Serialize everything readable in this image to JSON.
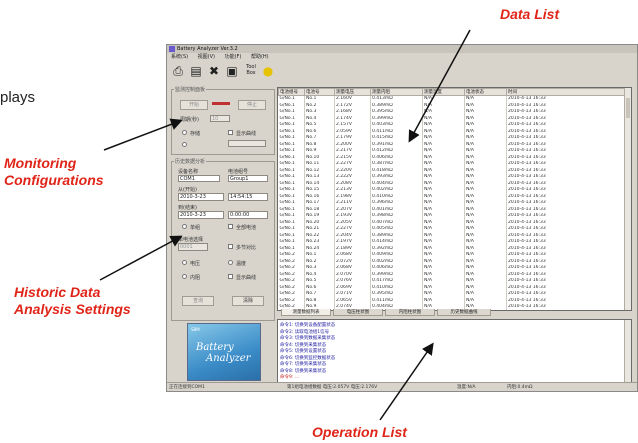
{
  "callouts": {
    "plays_fragment": "plays",
    "monitoring": [
      "Monitoring",
      "Configurations"
    ],
    "historic": [
      "Historic Data",
      "Analysis Settings"
    ],
    "data_list": "Data List",
    "operation_list": "Operation List"
  },
  "window": {
    "title": "Battery Analyzer Ver.3.2",
    "menu": [
      "系统(S)",
      "视图(V)",
      "功能(F)",
      "帮助(H)"
    ],
    "toolbar": {
      "icons": [
        "printer-icon",
        "page-icon",
        "tools-icon",
        "filter-icon",
        "tool-label-icon",
        "bulb-icon"
      ],
      "tool_label": "Tool Box"
    }
  },
  "monitor": {
    "title": "监测控制面板",
    "start": "开始",
    "stop": "停止",
    "period_label": "周期(秒)",
    "period_value": "10",
    "save_label": "存储",
    "display_label": "显示曲线"
  },
  "history": {
    "title": "历史数据分析",
    "device_label": "设备名称",
    "device_value": "COM1",
    "battery_label": "电池组号",
    "battery_value": "Group1",
    "from_label": "从(开始)",
    "from_date": "2010-3-23",
    "from_time": "14:54:15",
    "to_label": "到(结束)",
    "to_date": "2010-3-23",
    "to_time": "0:00:00",
    "opt_single": "单组",
    "opt_multi": "全部电池",
    "single_cell_label": "单电池选择",
    "single_cell_value": "0001",
    "compare_label": "多节对比",
    "voltage": "电压",
    "internal": "内阻",
    "temp": "温度",
    "curve": "显示曲线",
    "query": "查询",
    "clear": "清除"
  },
  "logo": {
    "line1": "Battery",
    "line2": "Analyzer",
    "small": "SBM"
  },
  "table": {
    "columns": [
      "电池组号",
      "电池号",
      "测量电压",
      "测量内阻",
      "测量温度",
      "电池状态",
      "时间"
    ],
    "rows": [
      [
        "G/No.1",
        "No.1",
        "2.160V",
        "0.413mΩ",
        "N/A",
        "N/A",
        "2010-4-13 16:33"
      ],
      [
        "G/No.1",
        "No.2",
        "2.172V",
        "0.389mΩ",
        "N/A",
        "N/A",
        "2010-4-13 16:33"
      ],
      [
        "G/No.1",
        "No.3",
        "2.168V",
        "0.395mΩ",
        "N/A",
        "N/A",
        "2010-4-13 16:33"
      ],
      [
        "G/No.1",
        "No.4",
        "2.174V",
        "0.399mΩ",
        "N/A",
        "N/A",
        "2010-4-13 16:33"
      ],
      [
        "G/No.1",
        "No.5",
        "2.157V",
        "0.403mΩ",
        "N/A",
        "N/A",
        "2010-4-13 16:33"
      ],
      [
        "G/No.1",
        "No.6",
        "2.059V",
        "0.411mΩ",
        "N/A",
        "N/A",
        "2010-4-13 16:33"
      ],
      [
        "G/No.1",
        "No.7",
        "2.179V",
        "0.415mΩ",
        "N/A",
        "N/A",
        "2010-4-13 16:33"
      ],
      [
        "G/No.1",
        "No.8",
        "2.200V",
        "0.391mΩ",
        "N/A",
        "N/A",
        "2010-4-13 16:33"
      ],
      [
        "G/No.1",
        "No.9",
        "2.217V",
        "0.412mΩ",
        "N/A",
        "N/A",
        "2010-4-13 16:33"
      ],
      [
        "G/No.1",
        "No.10",
        "2.215V",
        "0.406mΩ",
        "N/A",
        "N/A",
        "2010-4-13 16:33"
      ],
      [
        "G/No.1",
        "No.11",
        "2.227V",
        "0.387mΩ",
        "N/A",
        "N/A",
        "2010-4-13 16:33"
      ],
      [
        "G/No.1",
        "No.12",
        "2.220V",
        "0.418mΩ",
        "N/A",
        "N/A",
        "2010-4-13 16:33"
      ],
      [
        "G/No.1",
        "No.13",
        "2.222V",
        "0.393mΩ",
        "N/A",
        "N/A",
        "2010-4-13 16:33"
      ],
      [
        "G/No.1",
        "No.14",
        "2.208V",
        "0.404mΩ",
        "N/A",
        "N/A",
        "2010-4-13 16:33"
      ],
      [
        "G/No.1",
        "No.15",
        "2.213V",
        "0.402mΩ",
        "N/A",
        "N/A",
        "2010-4-13 16:33"
      ],
      [
        "G/No.1",
        "No.16",
        "2.198V",
        "0.410mΩ",
        "N/A",
        "N/A",
        "2010-4-13 16:33"
      ],
      [
        "G/No.1",
        "No.17",
        "2.211V",
        "0.396mΩ",
        "N/A",
        "N/A",
        "2010-4-13 16:33"
      ],
      [
        "G/No.1",
        "No.18",
        "2.207V",
        "0.401mΩ",
        "N/A",
        "N/A",
        "2010-4-13 16:33"
      ],
      [
        "G/No.1",
        "No.19",
        "2.193V",
        "0.398mΩ",
        "N/A",
        "N/A",
        "2010-4-13 16:33"
      ],
      [
        "G/No.1",
        "No.20",
        "2.205V",
        "0.407mΩ",
        "N/A",
        "N/A",
        "2010-4-13 16:33"
      ],
      [
        "G/No.1",
        "No.21",
        "2.227V",
        "0.405mΩ",
        "N/A",
        "N/A",
        "2010-4-13 16:33"
      ],
      [
        "G/No.1",
        "No.22",
        "2.204V",
        "0.389mΩ",
        "N/A",
        "N/A",
        "2010-4-13 16:33"
      ],
      [
        "G/No.1",
        "No.23",
        "2.197V",
        "0.414mΩ",
        "N/A",
        "N/A",
        "2010-4-13 16:33"
      ],
      [
        "G/No.1",
        "No.24",
        "2.189V",
        "0.392mΩ",
        "N/A",
        "N/A",
        "2010-4-13 16:33"
      ],
      [
        "G/No.2",
        "No.1",
        "2.068V",
        "0.409mΩ",
        "N/A",
        "N/A",
        "2010-4-13 16:33"
      ],
      [
        "G/No.2",
        "No.2",
        "2.072V",
        "0.402mΩ",
        "N/A",
        "N/A",
        "2010-4-13 16:33"
      ],
      [
        "G/No.2",
        "No.3",
        "2.068V",
        "0.406mΩ",
        "N/A",
        "N/A",
        "2010-4-13 16:33"
      ],
      [
        "G/No.2",
        "No.4",
        "2.070V",
        "0.399mΩ",
        "N/A",
        "N/A",
        "2010-4-13 16:33"
      ],
      [
        "G/No.2",
        "No.5",
        "2.076V",
        "0.417mΩ",
        "N/A",
        "N/A",
        "2010-4-13 16:33"
      ],
      [
        "G/No.2",
        "No.6",
        "2.069V",
        "0.410mΩ",
        "N/A",
        "N/A",
        "2010-4-13 16:33"
      ],
      [
        "G/No.2",
        "No.7",
        "2.071V",
        "0.395mΩ",
        "N/A",
        "N/A",
        "2010-4-13 16:33"
      ],
      [
        "G/No.2",
        "No.8",
        "2.065V",
        "0.411mΩ",
        "N/A",
        "N/A",
        "2010-4-13 16:33"
      ],
      [
        "G/No.2",
        "No.9",
        "2.074V",
        "0.404mΩ",
        "N/A",
        "N/A",
        "2010-4-13 16:33"
      ]
    ]
  },
  "tabs": [
    "测量数据列表",
    "电压柱状图",
    "内阻柱状图",
    "历史数据曲线"
  ],
  "operations": [
    "命令1: 切换到设备配置状态",
    "命令2: 读取电池组1信号",
    "命令3: 切换到数据采集状态",
    "命令4: 切换到采集状态",
    "命令5: 切换到设置状态",
    "命令6: 切换到监控数据状态",
    "命令7: 切换到采集状态",
    "命令8: 切换到采集状态",
    "命令9: ..."
  ],
  "status": {
    "left": "正在连接到COM1",
    "mid": "第1组电池组数据 电压:2.057V 电压:2.176V",
    "right1": "温度:N/A",
    "right2": "内阻:0.4mΩ"
  }
}
